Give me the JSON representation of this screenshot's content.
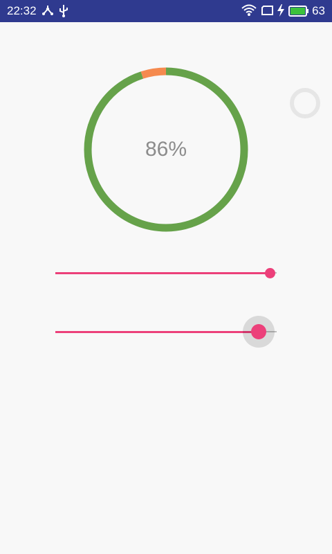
{
  "status_bar": {
    "time": "22:32",
    "battery_level": "63",
    "background_color": "#2f3a8f",
    "icons": [
      "tree-share-icon",
      "usb-icon",
      "wifi-icon",
      "tablet-icon",
      "charging-bolt-icon",
      "battery-icon"
    ]
  },
  "progress_ring": {
    "label": "86%",
    "progress": 0.95,
    "segment_progress": 0.05,
    "color": "#66a24a",
    "segment_color": "#f58a4f"
  },
  "spinner": {
    "color": "#e6e6e6"
  },
  "sliders": [
    {
      "value": 0.97,
      "pressed": false
    },
    {
      "value": 0.92,
      "pressed": true
    }
  ],
  "accent_color": "#ec407a"
}
